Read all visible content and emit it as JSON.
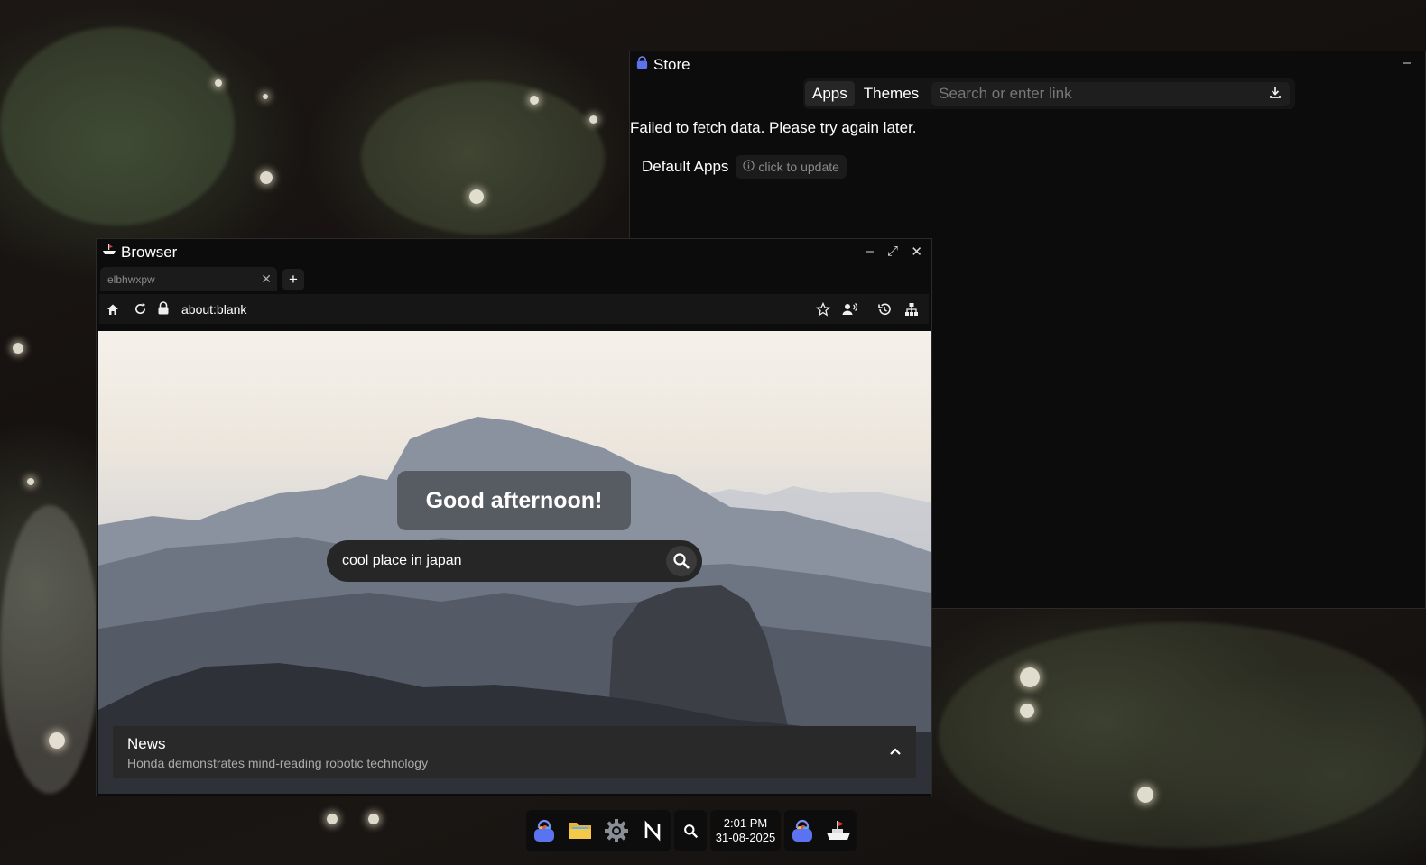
{
  "store": {
    "title": "Store",
    "tabs": [
      "Apps",
      "Themes"
    ],
    "search_placeholder": "Search or enter link",
    "error_message": "Failed to fetch data. Please try again later.",
    "default_apps_label": "Default Apps",
    "update_label": "click to update",
    "controls": {
      "minimize": "–"
    }
  },
  "browser": {
    "title": "Browser",
    "tab_title": "elbhwxpw",
    "new_tab_label": "+",
    "url": "about:blank",
    "controls": {
      "minimize": "–",
      "maximize": "⤢",
      "close": "✕"
    },
    "greeting": "Good afternoon!",
    "search_query": "cool place in japan",
    "news": {
      "title": "News",
      "headline": "Honda demonstrates mind-reading robotic technology"
    }
  },
  "taskbar": {
    "apps": [
      "store-icon",
      "files-icon",
      "settings-icon",
      "notes-icon",
      "search-icon"
    ],
    "clock": {
      "time": "2:01 PM",
      "date": "31-08-2025"
    },
    "open_apps": [
      "store-icon",
      "browser-icon"
    ]
  },
  "colors": {
    "accent": "#5b73f0",
    "window_bg": "#0c0c0c",
    "toolbar_bg": "#161616"
  }
}
